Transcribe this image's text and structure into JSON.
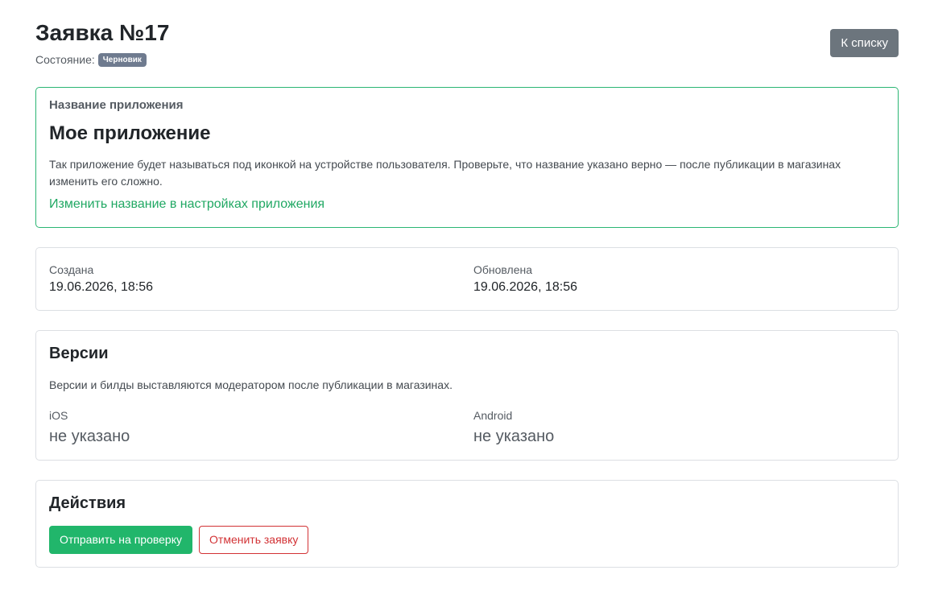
{
  "header": {
    "title": "Заявка №17",
    "status_label": "Состояние:",
    "status_badge": "Черновик",
    "back_button": "К списку"
  },
  "app_card": {
    "label": "Название приложения",
    "name": "Мое приложение",
    "description": "Так приложение будет называться под иконкой на устройстве пользователя. Проверьте, что название указано верно — после публикации в магазинах изменить его сложно.",
    "link": "Изменить название в настройках приложения"
  },
  "dates_card": {
    "created_label": "Создана",
    "created_value": "19.06.2026, 18:56",
    "updated_label": "Обновлена",
    "updated_value": "19.06.2026, 18:56"
  },
  "versions_card": {
    "title": "Версии",
    "note": "Версии и билды выставляются модератором после публикации в магазинах.",
    "ios_label": "iOS",
    "ios_value": "не указано",
    "android_label": "Android",
    "android_value": "не указано"
  },
  "actions_card": {
    "title": "Действия",
    "submit_button": "Отправить на проверку",
    "cancel_button": "Отменить заявку"
  },
  "colors": {
    "accent_green": "#21b66b",
    "danger_red": "#d23235",
    "secondary_gray": "#6c757d",
    "badge_gray": "#6f7b8f"
  }
}
